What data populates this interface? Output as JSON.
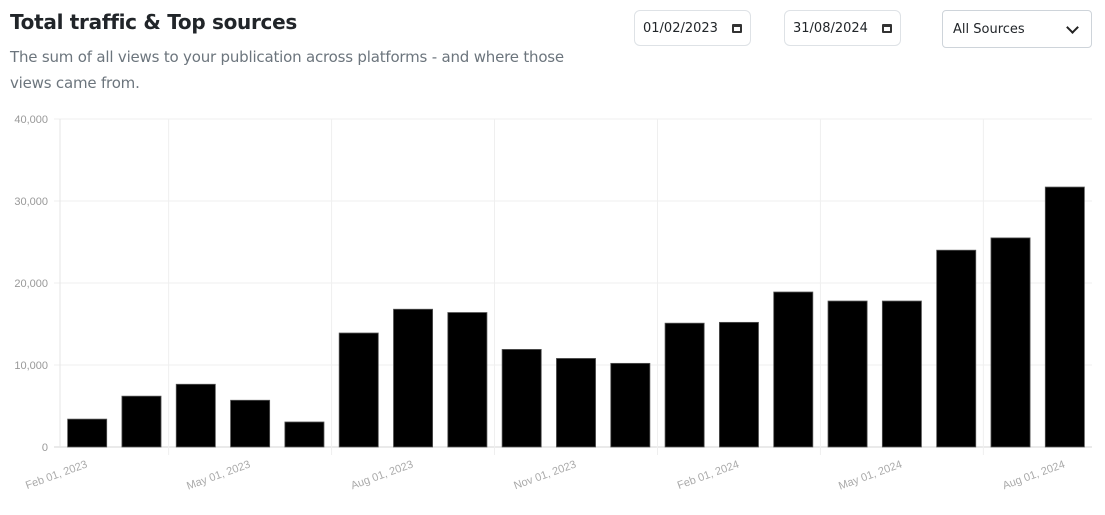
{
  "header": {
    "title": "Total traffic & Top sources",
    "subtitle": "The sum of all views to your publication across platforms - and where those views came from."
  },
  "filters": {
    "date_from": "01/02/2023",
    "date_to": "31/08/2024",
    "source_selected": "All Sources"
  },
  "chart_data": {
    "type": "bar",
    "title": "Total traffic",
    "xlabel": "",
    "ylabel": "",
    "ylim": [
      0,
      40000
    ],
    "y_ticks": [
      "0",
      "10,000",
      "20,000",
      "30,000",
      "40,000"
    ],
    "y_tick_values": [
      0,
      10000,
      20000,
      30000,
      40000
    ],
    "x_tick_labels": [
      "Feb 01, 2023",
      "May 01, 2023",
      "Aug 01, 2023",
      "Nov 01, 2023",
      "Feb 01, 2024",
      "May 01, 2024",
      "Aug 01, 2024"
    ],
    "categories": [
      "Feb 2023",
      "Mar 2023",
      "Apr 2023",
      "May 2023",
      "Jun 2023",
      "Jul 2023",
      "Aug 2023",
      "Sep 2023",
      "Oct 2023",
      "Nov 2023",
      "Dec 2023",
      "Jan 2024",
      "Feb 2024",
      "Mar 2024",
      "Apr 2024",
      "May 2024",
      "Jun 2024",
      "Jul 2024",
      "Aug 2024"
    ],
    "values": [
      3400,
      6200,
      7650,
      5700,
      3050,
      13900,
      16800,
      16400,
      11900,
      10800,
      10200,
      15100,
      15200,
      18900,
      17800,
      17800,
      24000,
      25500,
      31700
    ],
    "bar_color": "#000000",
    "grid": true,
    "legend": "none"
  }
}
